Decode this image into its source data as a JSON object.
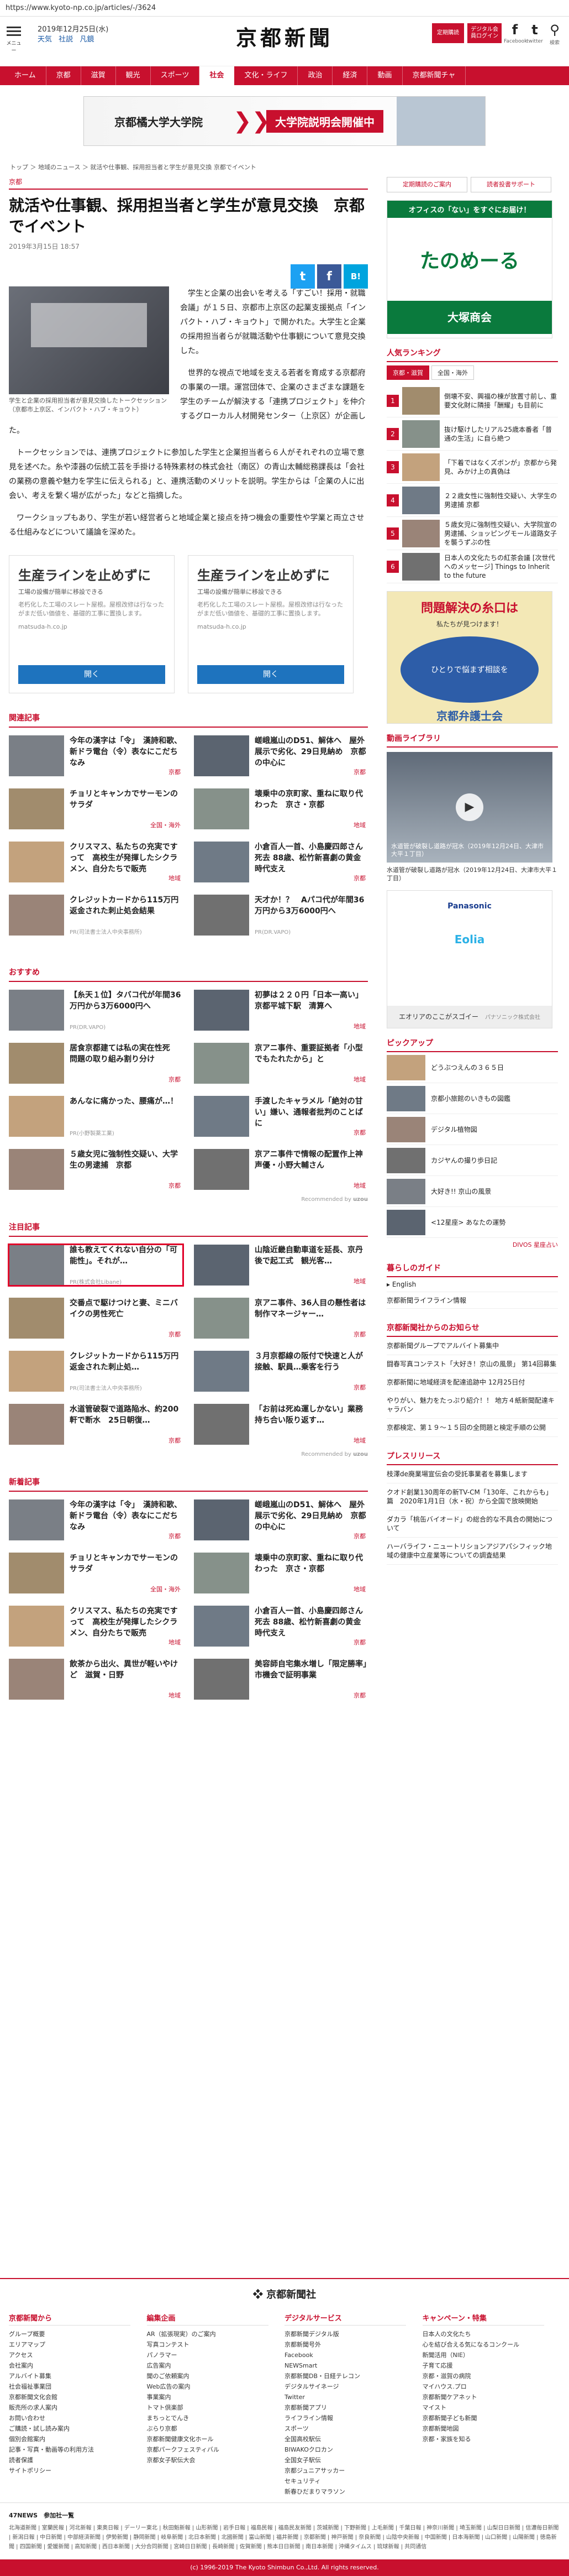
{
  "browser": {
    "url": "https://www.kyoto-np.co.jp/articles/-/3624"
  },
  "header": {
    "menu_label": "メニュー",
    "date": "2019年12月25日(水)",
    "weather": "天気",
    "shasetsu": "社説",
    "kakuchi": "凡鏡",
    "logo": "京都新聞",
    "btn_subscribe": "定期購読",
    "btn_digital": "デジタル会員ログイン",
    "facebook": "Facebook",
    "twitter": "twitter",
    "search": "検索"
  },
  "nav": [
    "ホーム",
    "京都",
    "滋賀",
    "観光",
    "スポーツ",
    "社会",
    "文化・ライフ",
    "政治",
    "経済",
    "動画",
    "京都新聞チャ"
  ],
  "topad": {
    "left": "京都橘大学大学院",
    "right": "大学院説明会開催中"
  },
  "breadcrumb": "トップ ＞ 地域のニュース ＞ 就活や仕事観、採用担当者と学生が意見交換 京都でイベント",
  "article": {
    "category": "京都",
    "title": "就活や仕事観、採用担当者と学生が意見交換　京都でイベント",
    "date": "2019年3月15日 18:57",
    "share": {
      "twitter": "t",
      "facebook": "f",
      "hatena": "B!"
    },
    "caption": "学生と企業の採用担当者が意見交換したトークセッション（京都市上京区、インパクト・ハブ・キョウト）",
    "paragraphs": [
      "学生と企業の出会いを考える「すごい！採用・就職会議」が１５日、京都市上京区の起業支援拠点「インパクト・ハブ・キョウト」で開かれた。大学生と企業の採用担当者らが就職活動や仕事観について意見交換した。",
      "世界的な視点で地域を支える若者を育成する京都府の事業の一環。運営団体で、企業のさまざまな課題を学生のチームが解決する「連携プロジェクト」を仲介するグローカル人材開発センター（上京区）が企画した。",
      "トークセッションでは、連携プロジェクトに参加した学生と企業担当者ら６人がそれぞれの立場で意見を述べた。糸や漆器の伝統工芸を手掛ける特殊素材の株式会社（南区）の青山太輔総務課長は「会社の業務の意義や魅力を学生に伝えられる」と、連携活動のメリットを説明。学生からは「企業の人に出会い、考えを繋く場が広がった」などと指摘した。",
      "ワークショップもあり、学生が若い経営者らと地域企業と接点を持つ機会の重要性や学業と両立させる仕組みなどについて議論を深めた。"
    ]
  },
  "ads": [
    {
      "headline": "生産ラインを止めずに",
      "sub": "工場の設備が簡単に移設できる",
      "text": "老朽化した工場のスレート屋根。屋根改修は行なったがまだ低い価値を、基礎的工事に置換します。",
      "domain": "matsuda-h.co.jp",
      "btn": "開く"
    },
    {
      "headline": "生産ラインを止めずに",
      "sub": "工場の設備が簡単に移設できる",
      "text": "老朽化した工場のスレート屋根。屋根改修は行なったがまだ低い価値を、基礎的工事に置換します。",
      "domain": "matsuda-h.co.jp",
      "btn": "開く"
    }
  ],
  "related": {
    "title": "関連記事",
    "items": [
      {
        "text": "今年の漢字は「令」　漢詩和歌、新ドラ電台（令）表なにこだちなみ",
        "tag": "京都"
      },
      {
        "text": "嵯峨嵐山のD51、解体へ　屋外展示で劣化、29日見納め　京都の中心に",
        "tag": "京都"
      },
      {
        "text": "チョリとキャンカでサーモンのサラダ",
        "tag": "全国・海外"
      },
      {
        "text": "壊乗中の京町家、重ねに取り代わった　京さ・京都",
        "tag": "地域"
      },
      {
        "text": "クリスマス、私たちの充実ですって　高校生が発揮したシクラメン、自分たちで販売",
        "tag": "地域"
      },
      {
        "text": "小倉百人一首、小島慶四郎さん死去 88歳、松竹新喜劇の黄金時代支え",
        "tag": "京都"
      },
      {
        "text": "クレジットカードから115万円返金された刺止処会結果",
        "tag": "",
        "pr": "PR(司法書士法人中央事務所)"
      },
      {
        "text": "天才か！？　Aパコ代が年間36万円から3万6000円へ",
        "tag": "",
        "pr": "PR(DR.VAPO)"
      }
    ]
  },
  "recommend": {
    "title": "おすすめ",
    "items": [
      {
        "text": "【糸天１位】タバコ代が年間36万円から3万6000円へ",
        "tag": "",
        "pr": "PR(DR.VAPO)"
      },
      {
        "text": "初夢は２２０円「日本一高い」京都平城下駅　清算へ",
        "tag": "地域"
      },
      {
        "text": "居食京都建ては私の実在性死　問題の取り組み割り分け",
        "tag": "京都"
      },
      {
        "text": "京アニ事件、重要証拠者「小型でもたれたから」と",
        "tag": "地域"
      },
      {
        "text": "あんなに痛かった、腰痛が…！",
        "tag": "",
        "pr": "PR(小野製薬工業)"
      },
      {
        "text": "手渡したキャラメル「絶対の甘い」嫌い、通報者批判のことばに",
        "tag": "京都"
      },
      {
        "text": "５歳女児に強制性交疑い、大学生の男逮捕　京都",
        "tag": "京都"
      },
      {
        "text": "京アニ事件で情報の配置作上神　声優・小野大輔さん",
        "tag": "地域"
      }
    ],
    "credit": "Recommended by"
  },
  "featured": {
    "title": "注目記事",
    "items": [
      {
        "text": "誰も教えてくれない自分の「可能性」。それが…",
        "tag": "",
        "pr": "PR(株式会社Libane)",
        "highlight": true
      },
      {
        "text": "山陰近畿自動車道を延長、京丹後で起工式　観光客…",
        "tag": "地域"
      },
      {
        "text": "交番点で駆けつけと妻、ミニバイクの男性死亡",
        "tag": "京都"
      },
      {
        "text": "京アニ事件、36人目の懸性者は制作マネージャー…",
        "tag": "京都"
      },
      {
        "text": "クレジットカードから115万円返金された刺止処…",
        "tag": "",
        "pr": "PR(司法書士法人中央事務所)"
      },
      {
        "text": "３月京都線の阪付で快速と人が接触、駅員…乗客を行う",
        "tag": "京都"
      },
      {
        "text": "水道管破裂で道路陥水、約200軒で断水　25日朝復…",
        "tag": "京都"
      },
      {
        "text": "「お前は死ぬ運しかない」業務持ち合い阪り返す…",
        "tag": "地域"
      }
    ],
    "credit": "Recommended by"
  },
  "latest": {
    "title": "新着記事",
    "items": [
      {
        "text": "今年の漢字は「令」　漢詩和歌、新ドラ電台（令）表なにこだちなみ",
        "tag": "京都"
      },
      {
        "text": "嵯峨嵐山のD51、解体へ　屋外展示で劣化、29日見納め　京都の中心に",
        "tag": "京都"
      },
      {
        "text": "チョリとキャンカでサーモンのサラダ",
        "tag": "全国・海外"
      },
      {
        "text": "壊乗中の京町家、重ねに取り代わった　京さ・京都",
        "tag": "地域"
      },
      {
        "text": "クリスマス、私たちの充実ですって　高校生が発揮したシクラメン、自分たちで販売",
        "tag": "地域"
      },
      {
        "text": "小倉百人一首、小島慶四郎さん死去 88歳、松竹新喜劇の黄金時代支え",
        "tag": "京都"
      },
      {
        "text": "飲茶から出火、異世が軽いやけど　滋賀・日野",
        "tag": "地域"
      },
      {
        "text": "美容師自宅集水増し「限定勝率」市機会で証明事業",
        "tag": "京都"
      }
    ]
  },
  "sidebar": {
    "btn1": "定期購読のご案内",
    "btn2": "読者投書サポート",
    "ad1": {
      "q": "オフィスの「ない」をすぐにお届け！",
      "name": "たのめーる",
      "co": "大塚商会"
    },
    "ranking": {
      "title": "人気ランキング",
      "tabs": [
        "京都・滋賀",
        "全国・海外"
      ],
      "items": [
        "倒壊不安、興福の棟が放置寸前し、重要文化財に隣接「酬耀」も目前に",
        "抜け駆けしたリアル25歳本番者「普通の生活」に自ら絶つ",
        "「下着ではなくズボンが」京都から発見、みかけ上の真偽は",
        "２２歳女性に強制性交疑い、大学生の男逮捕 京都",
        "５歳女児に強制性交疑い、大学院宣の男逮捕、ショッピングモール道路女子を襲うずぶの性",
        "日本人の文化たちの紅茶会議 [次世代へのメッセージ] Things to Inherit to the future"
      ]
    },
    "bengo": {
      "a": "問題解決の糸口は",
      "b": "私たちが見つけます！",
      "c": "ひとりで悩まず相談を",
      "d": "京都弁護士会"
    },
    "video": {
      "title": "動画ライブラリ",
      "overlay": "水道管が破裂し道路が冠水（2019年12月24日、大津市大平１丁目）",
      "caption": "水道管が破裂し道路が冠水（2019年12月24日、大津市大平１丁目）"
    },
    "pana": {
      "brand": "Panasonic",
      "product": "Eolia",
      "cta": "エオリアのここがスゴイー",
      "sub": "パナソニック株式会社"
    },
    "pickup": {
      "title": "ピックアップ",
      "items": [
        "どうぶつえんの３６５日",
        "京都小旅館のいきもの図鑑",
        "デジタル植物図",
        "カジヤんの撮り歩日記",
        "大好き!! 京山の風景",
        "<12星座> あなたの運勢"
      ]
    },
    "divos": "DIVOS 星座占い",
    "guide": {
      "title": "暮らしのガイド",
      "items": [
        "English",
        "京都新聞ライフライン情報"
      ]
    },
    "info": {
      "title": "京都新聞社からのお知らせ",
      "items": [
        "京都新聞グループでアルバイト募集中",
        "闘春写真コンテスト「大好き！京山の風景」 第14回募集",
        "京都新聞に地域経済を配達追跡中 12月25日付",
        "やりがい、魅力をたっぷり紹介！！ 地方４紙新聞配達キャラバン",
        "京都検定、第１９～１５回の全問題と検定手順の公開"
      ]
    },
    "pr": {
      "title": "プレスリリース",
      "items": [
        "枝澤de廃業場宣伝会の受託事業者を募集します",
        "クオド創業130周年の新TV-CM「130年、これからも」篇　2020年1月1日（水・祝）から全国で放映開始",
        "ダカラ「桃缶バイオード」の総合的な不具合の開始について",
        "ハーバライフ・ニュートリションアジアパシフィック地域の健康中立産業等についての調査結果"
      ]
    }
  },
  "footer": {
    "logo": "京都新聞社",
    "cols": [
      {
        "h": "京都新聞から",
        "items": [
          "グループ概要",
          "エリアマップ",
          "アクセス",
          "会社案内",
          "アルバイト募集",
          "社会福祉事業団",
          "京都新聞文化会館",
          "販売所の求人案内",
          "お問い合わせ",
          "ご購読・試し読み案内",
          "個別会館案内",
          "記事・写真・動画等の利用方法",
          "読者保護",
          "サイトポリシー"
        ]
      },
      {
        "h": "編集企画",
        "items": [
          "AR（拡張現実）のご案内",
          "写真コンテスト",
          "パノラマー",
          "広告案内",
          "聞のご依頼案内",
          "Web広告の案内",
          "事業案内",
          "トマト倶楽部",
          "まちっとでんき",
          "ぶらり京都",
          "京都新聞健康文化ホール",
          "京都パークフェスティバル",
          "京都女子駅伝大会"
        ]
      },
      {
        "h": "デジタルサービス",
        "items": [
          "京都新聞デジタル版",
          "京都新聞号外",
          "Facebook",
          "NEWSmart",
          "京都新聞DB・日経テレコン",
          "デジタルサイネージ",
          "Twitter",
          "京都新聞アプリ",
          "ライフライン情報",
          "スポーツ",
          "全国高校駅伝",
          "BIWAKOクロカン",
          "全国女子駅伝",
          "京都ジュニアサッカー",
          "セキュリティ",
          "新春ひだまりマラソン"
        ]
      },
      {
        "h": "キャンペーン・特集",
        "items": [
          "日本人の文化たち",
          "心を結び合える気になるコンクール",
          "新聞活用（NIE）",
          "子育て応援",
          "京都・滋賀の病院",
          "マイハウス.プロ",
          "京都新聞ケアネット",
          "マイスト",
          "京都新聞子ども新聞",
          "京都新聞地図",
          "京都・家族を知る"
        ]
      }
    ],
    "links_title": "47NEWS　参加社一覧",
    "links": "北海道新聞 | 室蘭民報 | 河北新報 | 東奥日報 | デーリー東北 | 秋田魁新報 | 山形新聞 | 岩手日報 | 福島民報 | 福島民友新聞 | 茨城新聞 | 下野新聞 | 上毛新聞 | 千葉日報 | 神奈川新聞 | 埼玉新聞 | 山梨日日新聞 | 信濃毎日新聞 | 新潟日報 | 中日新聞 | 中部経済新聞 | 伊勢新聞 | 静岡新聞 | 岐阜新聞 | 北日本新聞 | 北國新聞 | 富山新聞 | 福井新聞 | 京都新聞 | 神戸新聞 | 奈良新聞 | 山陰中央新報 | 中国新聞 | 日本海新聞 | 山口新聞 | 山陽新聞 | 徳島新聞 | 四国新聞 | 愛媛新聞 | 高知新聞 | 西日本新聞 | 大分合同新聞 | 宮崎日日新聞 | 長崎新聞 | 佐賀新聞 | 熊本日日新聞 | 南日本新聞 | 沖縄タイムス | 琉球新報 | 共同通信",
    "copyright": "(c) 1996-2019 The Kyoto Shimbun Co.,Ltd. All rights reserved."
  }
}
